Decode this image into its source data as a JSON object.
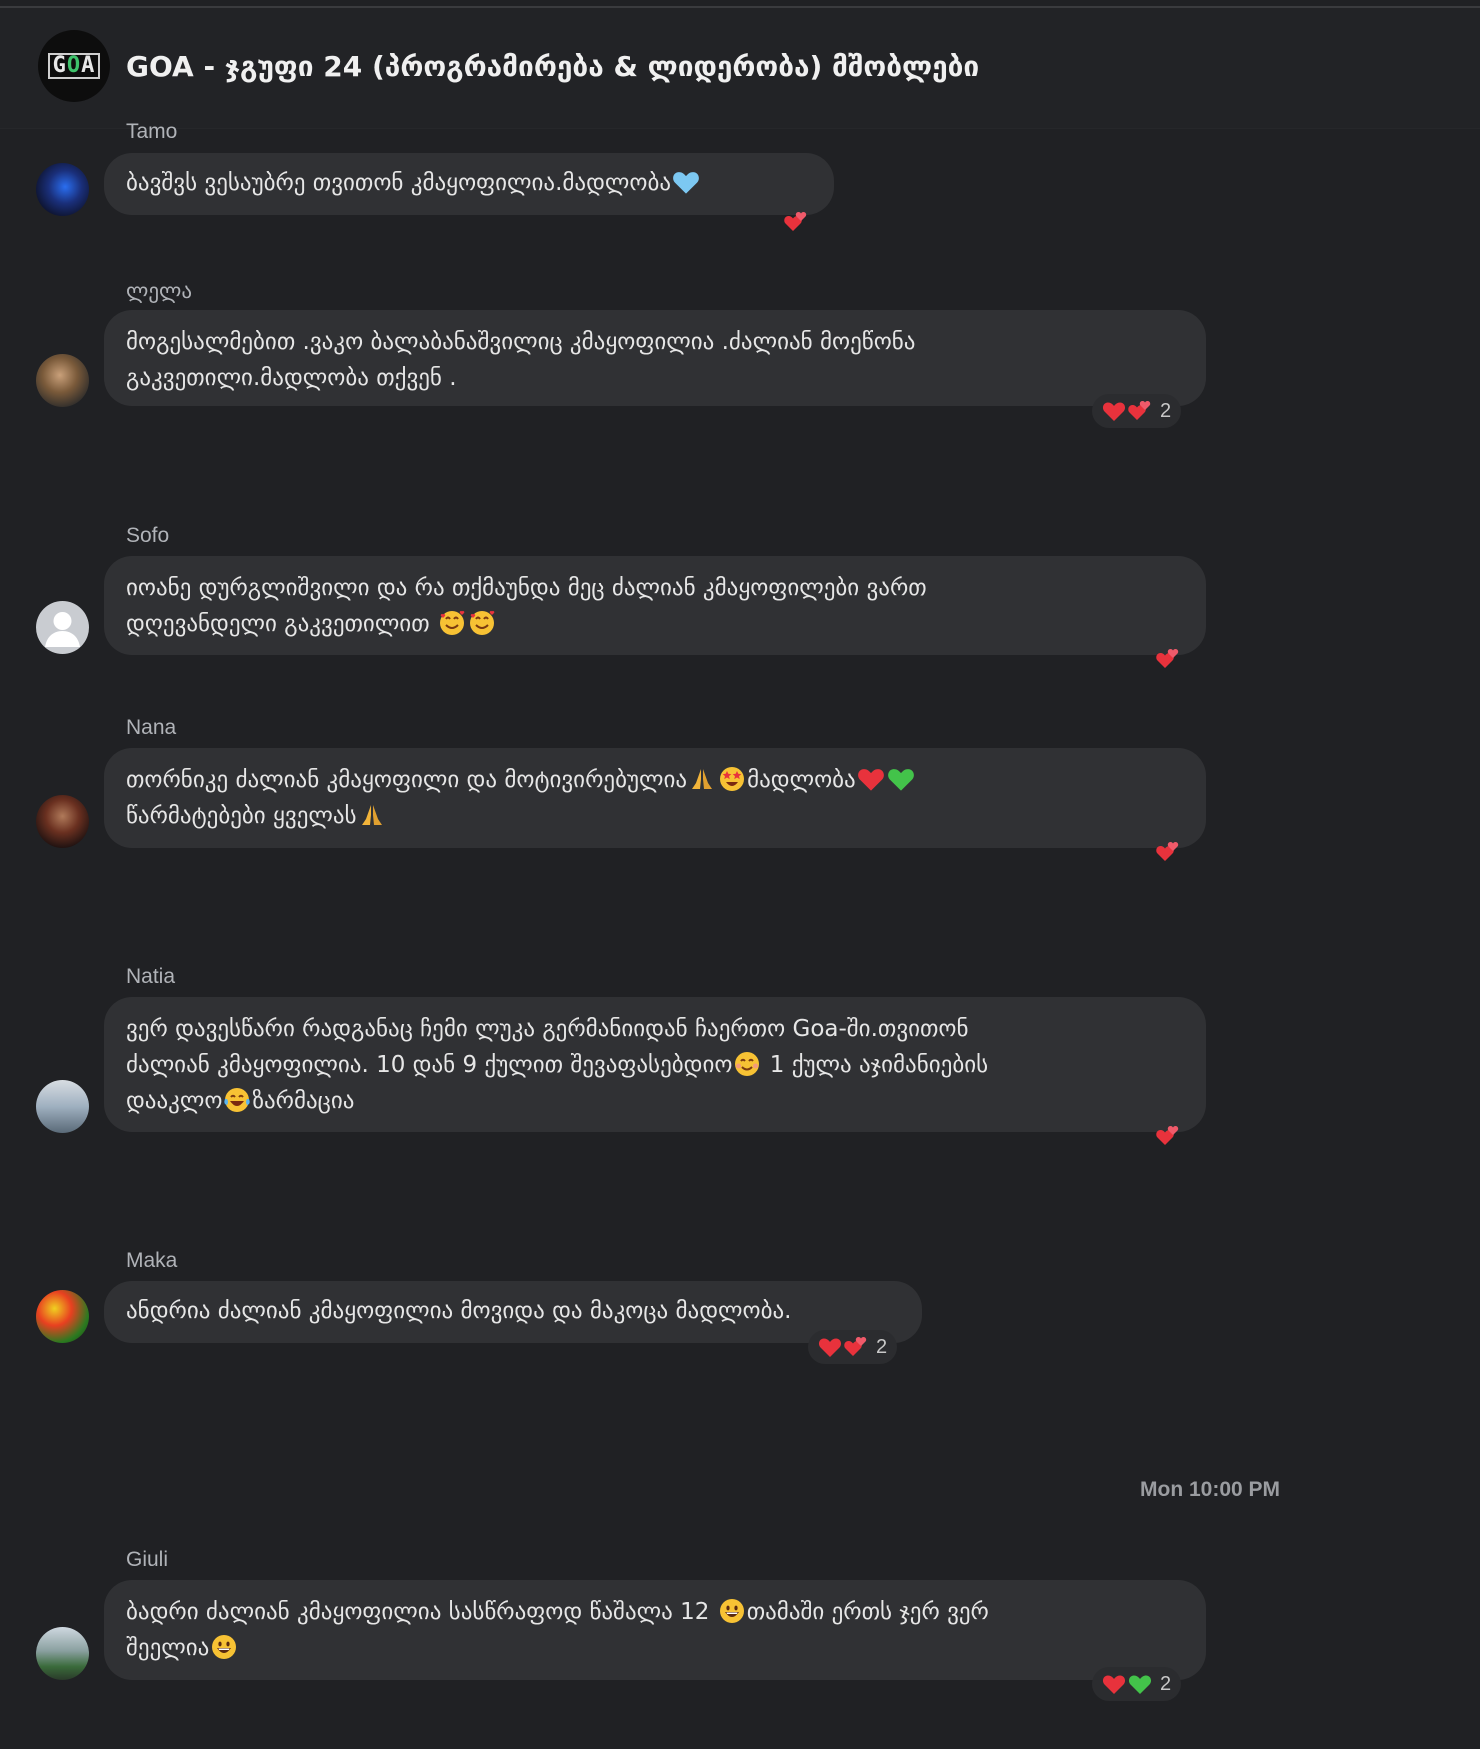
{
  "header": {
    "title": "GOA - ჯგუფი 24 (პროგრამირება & ლიდერობა) მშობლები",
    "avatar_logo": "GOA"
  },
  "messages": [
    {
      "sender": "Tamo",
      "text": "ბავშვს ვესაუბრე თვითონ კმაყოფილია.მადლობა",
      "trailing_emoji": "light-blue-heart",
      "reactions": [
        "two-hearts"
      ],
      "reaction_count": ""
    },
    {
      "sender": "ლელა",
      "line1": "მოგესალმებით .ვაკო ბალაბანაშვილიც კმაყოფილია .ძალიან მოეწონა",
      "line2": "გაკვეთილი.მადლობა თქვენ .",
      "reactions": [
        "red-heart",
        "two-hearts"
      ],
      "reaction_count": "2"
    },
    {
      "sender": "Sofo",
      "line1": "იოანე დურგლიშვილი  და რა თქმაუნდა მეც ძალიან კმაყოფილები ვართ",
      "line2": "დღევანდელი გაკვეთილით",
      "reactions": [
        "two-hearts"
      ],
      "reaction_count": ""
    },
    {
      "sender": "Nana",
      "line1a": "თორნიკე ძალიან კმაყოფილი და მოტივირებულია",
      "line1b": "მადლობა",
      "line2": "წარმატებები ყველას",
      "reactions": [
        "two-hearts"
      ],
      "reaction_count": ""
    },
    {
      "sender": "Natia",
      "line1": "ვერ დავესწარი რადგანაც ჩემი ლუკა გერმანიიდან ჩაერთო Goa-ში.თვითონ",
      "line2a": "ძალიან კმაყოფილია.  10 დან 9 ქულით შევაფასებდიო",
      "line2b": " 1 ქულა აჯიმანიების",
      "line3a": "დააკლო",
      "line3b": "ზარმაცია",
      "reactions": [
        "two-hearts"
      ],
      "reaction_count": ""
    },
    {
      "sender": "Maka",
      "text": "ანდრია ძალიან კმაყოფილია მოვიდა და მაკოცა მადლობა.",
      "reactions": [
        "red-heart",
        "two-hearts"
      ],
      "reaction_count": "2"
    },
    {
      "sender": "Giuli",
      "line1a": "ბადრი ძალიან კმაყოფილია სასწრაფოდ წაშალა 12 ",
      "line1b": "თამაში ერთს ჯერ ვერ",
      "line2": "შეელია",
      "reactions": [
        "red-heart",
        "green-heart"
      ],
      "reaction_count": "2"
    }
  ],
  "timestamp": "Mon 10:00 PM",
  "colors": {
    "background": "#202124",
    "bubble": "#303134",
    "sender": "#b0b3b8",
    "text": "#e6e6e6",
    "heart_red": "#e8323c",
    "heart_green": "#43c34a",
    "heart_light_blue": "#7cc8f2"
  }
}
